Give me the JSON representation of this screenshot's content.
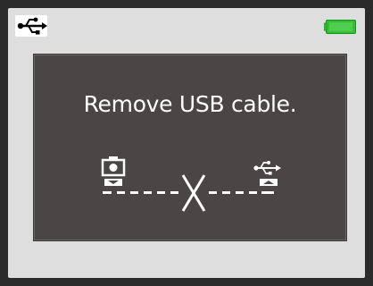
{
  "status_bar": {
    "left_icon": "usb-icon",
    "right_icon": "battery-full-icon",
    "battery_color": "#2fc12f"
  },
  "dialog": {
    "message": "Remove USB cable.",
    "diagram": {
      "left_icon": "camera-icon",
      "right_icon": "usb-icon",
      "center_icon": "cross-icon",
      "line_style": "dashed"
    }
  }
}
